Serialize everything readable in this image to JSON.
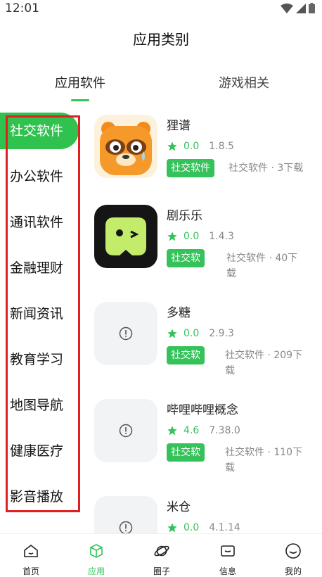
{
  "status": {
    "time": "12:01"
  },
  "title": "应用类别",
  "tabs": {
    "apps": "应用软件",
    "games": "游戏相关"
  },
  "sidebar": {
    "items": [
      "社交软件",
      "办公软件",
      "通讯软件",
      "金融理财",
      "新闻资讯",
      "教育学习",
      "地图导航",
      "健康医疗",
      "影音播放"
    ],
    "active": "社交软件"
  },
  "apps": [
    {
      "name": "狸谱",
      "rating": "0.0",
      "version": "1.8.5",
      "tag": "社交软件",
      "desc": "社交软件 · 3下载"
    },
    {
      "name": "剧乐乐",
      "rating": "0.0",
      "version": "1.4.3",
      "tag": "社交软",
      "desc1": "社交软件 · 40下",
      "desc2": "载"
    },
    {
      "name": "多糖",
      "rating": "0.0",
      "version": "2.9.3",
      "tag": "社交软",
      "desc1": "社交软件 · 209下",
      "desc2": "载"
    },
    {
      "name": "哔哩哔哩概念",
      "rating": "4.6",
      "version": "7.38.0",
      "tag": "社交软",
      "desc1": "社交软件 · 110下",
      "desc2": "载"
    },
    {
      "name": "米仓",
      "rating": "0.0",
      "version": "4.1.14"
    }
  ],
  "nav": {
    "home": "首页",
    "apps": "应用",
    "circle": "圈子",
    "messages": "信息",
    "me": "我的"
  },
  "colors": {
    "accent": "#35c25a",
    "highlight_box": "#e02020"
  }
}
